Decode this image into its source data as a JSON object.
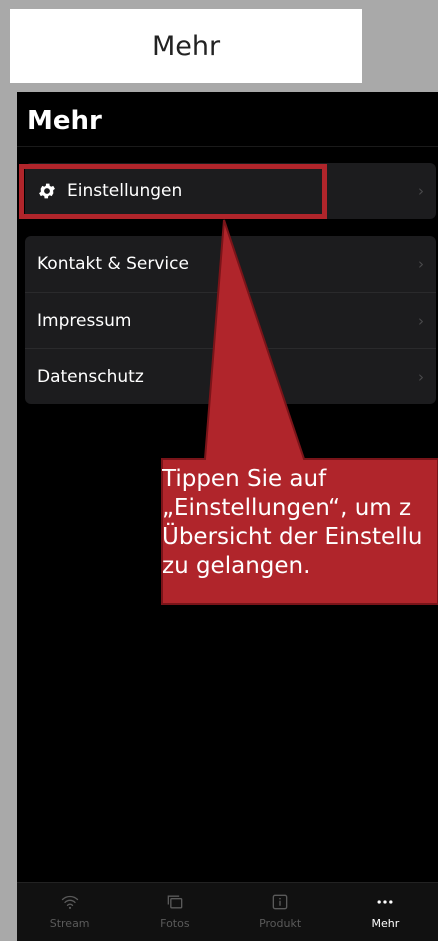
{
  "doc_title": "Mehr",
  "screen": {
    "title": "Mehr",
    "settings_item": {
      "label": "Einstellungen",
      "icon": "gear-icon"
    },
    "menu_items": [
      {
        "label": "Kontakt & Service"
      },
      {
        "label": "Impressum"
      },
      {
        "label": "Datenschutz"
      }
    ],
    "chevron": "›"
  },
  "callout": {
    "text_lines": [
      "Tippen Sie auf",
      "„Einstellungen“, um z",
      "Übersicht der Einstellu",
      "zu gelangen."
    ],
    "color": "#b0252b"
  },
  "tabbar": {
    "tabs": [
      {
        "label": "Stream",
        "icon": "wifi-icon",
        "active": false
      },
      {
        "label": "Fotos",
        "icon": "photos-icon",
        "active": false
      },
      {
        "label": "Produkt",
        "icon": "info-icon",
        "active": false
      },
      {
        "label": "Mehr",
        "icon": "more-icon",
        "active": true
      }
    ]
  }
}
